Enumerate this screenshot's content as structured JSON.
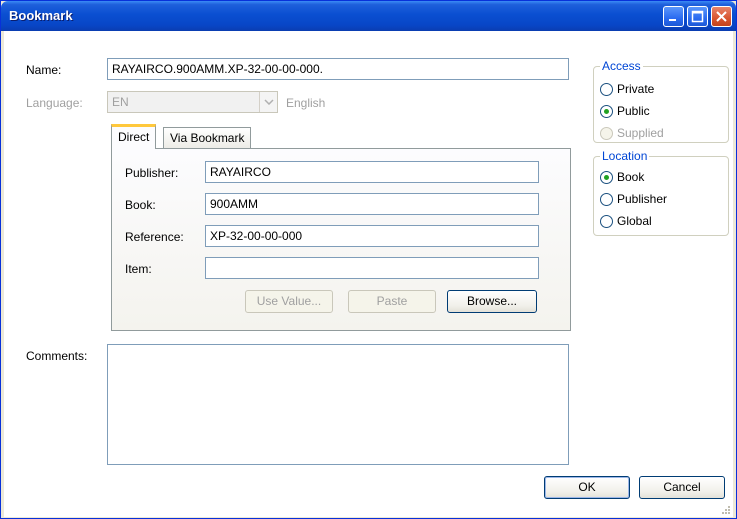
{
  "window": {
    "title": "Bookmark"
  },
  "fields": {
    "name_label": "Name:",
    "name_value": "RAYAIRCO.900AMM.XP-32-00-00-000.",
    "language_label": "Language:",
    "language_value": "EN",
    "language_name": "English",
    "comments_label": "Comments:",
    "comments_value": ""
  },
  "tabs": [
    {
      "label": "Direct",
      "active": true
    },
    {
      "label": "Via Bookmark",
      "active": false
    }
  ],
  "direct": {
    "publisher_label": "Publisher:",
    "publisher_value": "RAYAIRCO",
    "book_label": "Book:",
    "book_value": "900AMM",
    "reference_label": "Reference:",
    "reference_value": "XP-32-00-00-000",
    "item_label": "Item:",
    "item_value": ""
  },
  "buttons": {
    "use_value": "Use Value...",
    "paste": "Paste",
    "browse": "Browse...",
    "ok": "OK",
    "cancel": "Cancel"
  },
  "access": {
    "legend": "Access",
    "options": [
      {
        "label": "Private",
        "checked": false,
        "disabled": false
      },
      {
        "label": "Public",
        "checked": true,
        "disabled": false
      },
      {
        "label": "Supplied",
        "checked": false,
        "disabled": true
      }
    ]
  },
  "location": {
    "legend": "Location",
    "options": [
      {
        "label": "Book",
        "checked": true
      },
      {
        "label": "Publisher",
        "checked": false
      },
      {
        "label": "Global",
        "checked": false
      }
    ]
  },
  "colors": {
    "titlebar": "#0a4fd1",
    "accent": "#0046d5",
    "tab_highlight": "#ffc83c",
    "radio_dot": "#21a121"
  }
}
